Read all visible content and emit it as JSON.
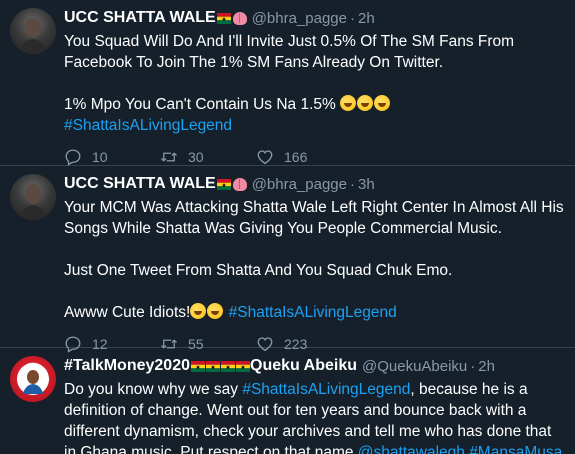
{
  "tweets": [
    {
      "name": "UCC SHATTA WALE",
      "handle": "@bhra_pagge",
      "time": "2h",
      "lines": [
        "You Squad Will Do And I'll Invite Just 0.5% Of The SM Fans From Facebook To Join The 1% SM Fans Already On Twitter.",
        "",
        "1% Mpo You Can't Contain Us Na 1.5%"
      ],
      "hashtag": "#ShattaIsALivingLegend",
      "replies": "10",
      "retweets": "30",
      "likes": "166"
    },
    {
      "name": "UCC SHATTA WALE",
      "handle": "@bhra_pagge",
      "time": "3h",
      "lines": [
        "Your MCM Was Attacking Shatta Wale Left Right Center In Almost All His Songs While Shatta Was Giving You People Commercial Music.",
        "",
        "Just One Tweet From Shatta And You Squad Chuk Emo.",
        "",
        "Awww Cute Idiots!"
      ],
      "hashtag": "#ShattaIsALivingLegend",
      "replies": "12",
      "retweets": "55",
      "likes": "223"
    },
    {
      "name_prefix": "#TalkMoney2020",
      "name_suffix": "Queku Abeiku",
      "handle": "@QuekuAbeiku",
      "time": "2h",
      "text_a": "Do you know why we say ",
      "hashtag": "#ShattaIsALivingLegend",
      "text_b": ", because he is a definition of change. Went out for ten years and bounce back with a different dynamism, check your archives and tell me who has done that in Ghana music. Put respect on that name ",
      "mention": "@shattawalegh",
      "hashtag2": "#MansaMusa"
    }
  ],
  "icons": [
    "reply-icon",
    "retweet-icon",
    "like-icon"
  ],
  "colors": {
    "background": "#15202b",
    "muted": "#8899a6",
    "link": "#1da1f2",
    "divider": "#38444d"
  }
}
